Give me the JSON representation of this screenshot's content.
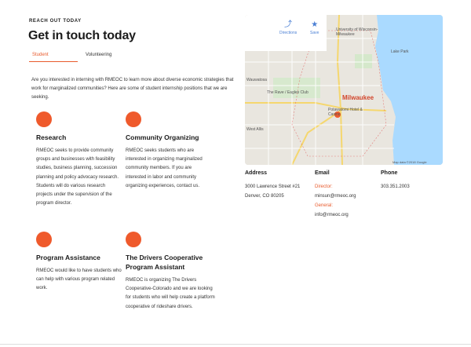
{
  "header": {
    "eyebrow": "REACH OUT TODAY",
    "title": "Get in touch today"
  },
  "tabs": [
    {
      "label": "Student",
      "active": true
    },
    {
      "label": "Volunteering",
      "active": false
    }
  ],
  "intro": "Are you interested in interning with RMEOC to learn more about diverse economic strategies that work for marginalized communities? Here are some of student internship positions that we are seeking.",
  "cards": [
    {
      "title": "Research",
      "body": "RMEOC seeks to provide community groups and businesses with feasibility studies, business planning, succession planning and policy advocacy research. Students will do various research projects under the supervision of the program director."
    },
    {
      "title": "Community Organizing",
      "body": "RMEOC seeks students who are interested in organizing marginalized community members. If you are interested in labor and community organizing experiences, contact us."
    },
    {
      "title": "Program Assistance",
      "body": "RMEOC would like to have students who can help with various program related work."
    },
    {
      "title": "The Drivers Cooperative Program Assistant",
      "body": "RMEOC is organizing The Drivers Cooperative-Colorado and we are looking for students who will help create a platform cooperative of rideshare drivers."
    }
  ],
  "map": {
    "directions_label": "Directions",
    "save_label": "Save",
    "city_label": "Milwaukee",
    "places": [
      "University of Wisconsin-Milwaukee",
      "Lake Park",
      "The Rave / Eagles Club",
      "Potawatomi Hotel & Casino",
      "West Allis",
      "Wauwatosa"
    ],
    "attribution": "Map data ©2018 Google",
    "water_color": "#aadaff",
    "land_color": "#e9e6df",
    "accent_color": "#ef5a2c"
  },
  "contact": {
    "address": {
      "heading": "Address",
      "line1": "3000 Lawrence Street #21",
      "line2": "Denver, CO 80205"
    },
    "email": {
      "heading": "Email",
      "director_label": "Director:",
      "director_email": "minsun@rmeoc.org",
      "general_label": "General:",
      "general_email": "info@rmeoc.org"
    },
    "phone": {
      "heading": "Phone",
      "number": "303.351.2003"
    }
  }
}
